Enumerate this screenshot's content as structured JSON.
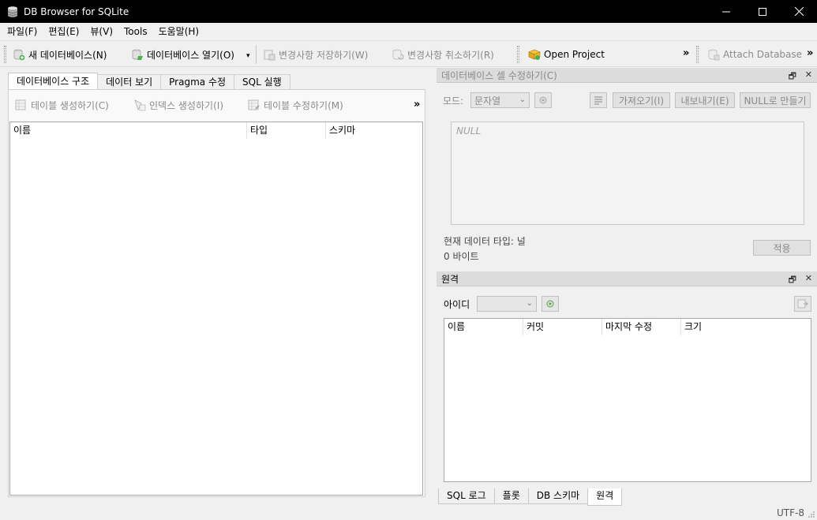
{
  "window": {
    "title": "DB Browser for SQLite",
    "minimize": "—",
    "maximize": "☐",
    "close": "✕"
  },
  "menu": [
    "파일(F)",
    "편집(E)",
    "뷰(V)",
    "Tools",
    "도움말(H)"
  ],
  "toolbar": {
    "new_db": "새 데이터베이스(N)",
    "open_db": "데이터베이스 열기(O)",
    "write_changes": "변경사항 저장하기(W)",
    "revert_changes": "변경사항 취소하기(R)",
    "open_project": "Open Project",
    "attach_db": "Attach Database",
    "more": "»",
    "dropdown_arrow": "▾"
  },
  "main_tabs": [
    "데이터베이스 구조",
    "데이터 보기",
    "Pragma 수정",
    "SQL 실행"
  ],
  "structure_toolbar": {
    "create_table": "테이블 생성하기(C)",
    "create_index": "인덱스 생성하기(I)",
    "modify_table": "테이블 수정하기(M)",
    "more": "»"
  },
  "structure_columns": [
    "이름",
    "타입",
    "스키마"
  ],
  "edit_cell": {
    "title": "데이터베이스 셀 수정하기(C)",
    "mode_label": "모드:",
    "mode_value": "문자열",
    "import": "가져오기(I)",
    "export": "내보내기(E)",
    "set_null": "NULL로 만들기",
    "placeholder": "NULL",
    "type_info": "현재 데이터 타입: 널",
    "size_info": "0 바이트",
    "apply": "적용"
  },
  "remote": {
    "title": "원격",
    "id_label": "아이디",
    "id_value": "",
    "columns": [
      "이름",
      "커밋",
      "마지막 수정",
      "크기"
    ]
  },
  "bottom_tabs": [
    "SQL 로그",
    "플롯",
    "DB 스키마",
    "원격"
  ],
  "status": {
    "encoding": "UTF-8"
  },
  "dock_controls": {
    "float": "🗗",
    "close": "✕"
  }
}
